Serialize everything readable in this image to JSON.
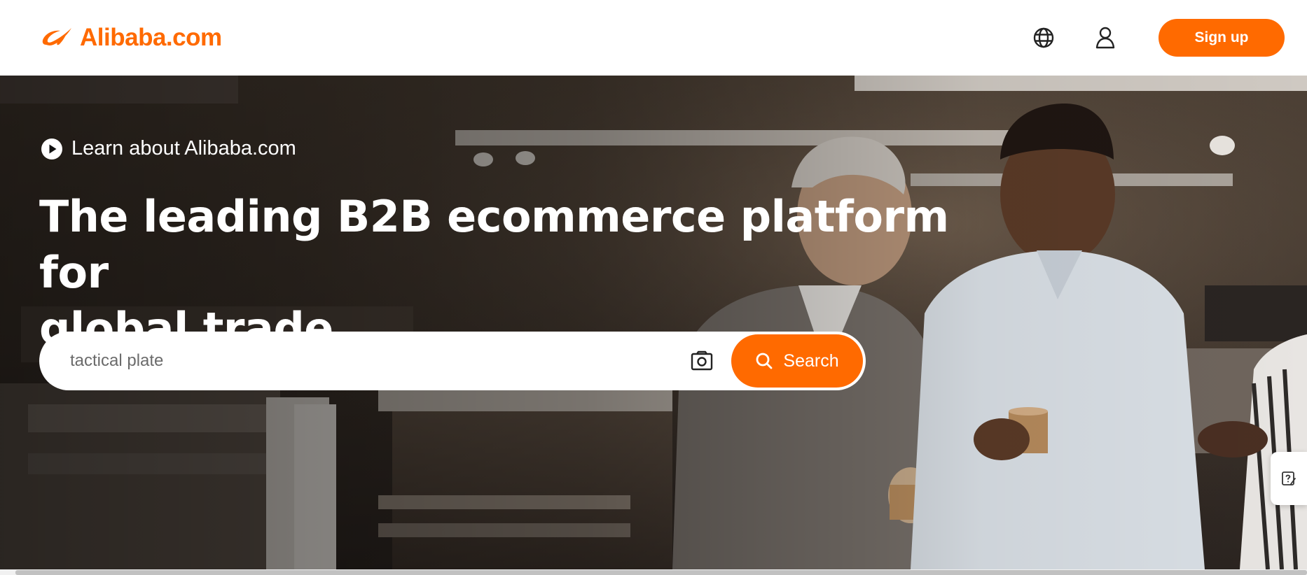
{
  "header": {
    "logo_text": "Alibaba.com",
    "signup_label": "Sign up",
    "icons": {
      "language": "globe-icon",
      "account": "user-icon"
    }
  },
  "hero": {
    "learn_link_label": "Learn about Alibaba.com",
    "title_line1": "The leading B2B ecommerce platform for",
    "title_line2": "global trade",
    "search": {
      "placeholder": "tactical plate",
      "button_label": "Search",
      "image_search_icon": "camera-icon",
      "search_icon": "search-icon"
    }
  },
  "side": {
    "feedback_icon": "feedback-icon"
  },
  "colors": {
    "brand": "#ff6a00",
    "header_bg": "#ffffff",
    "text_light": "#ffffff"
  }
}
